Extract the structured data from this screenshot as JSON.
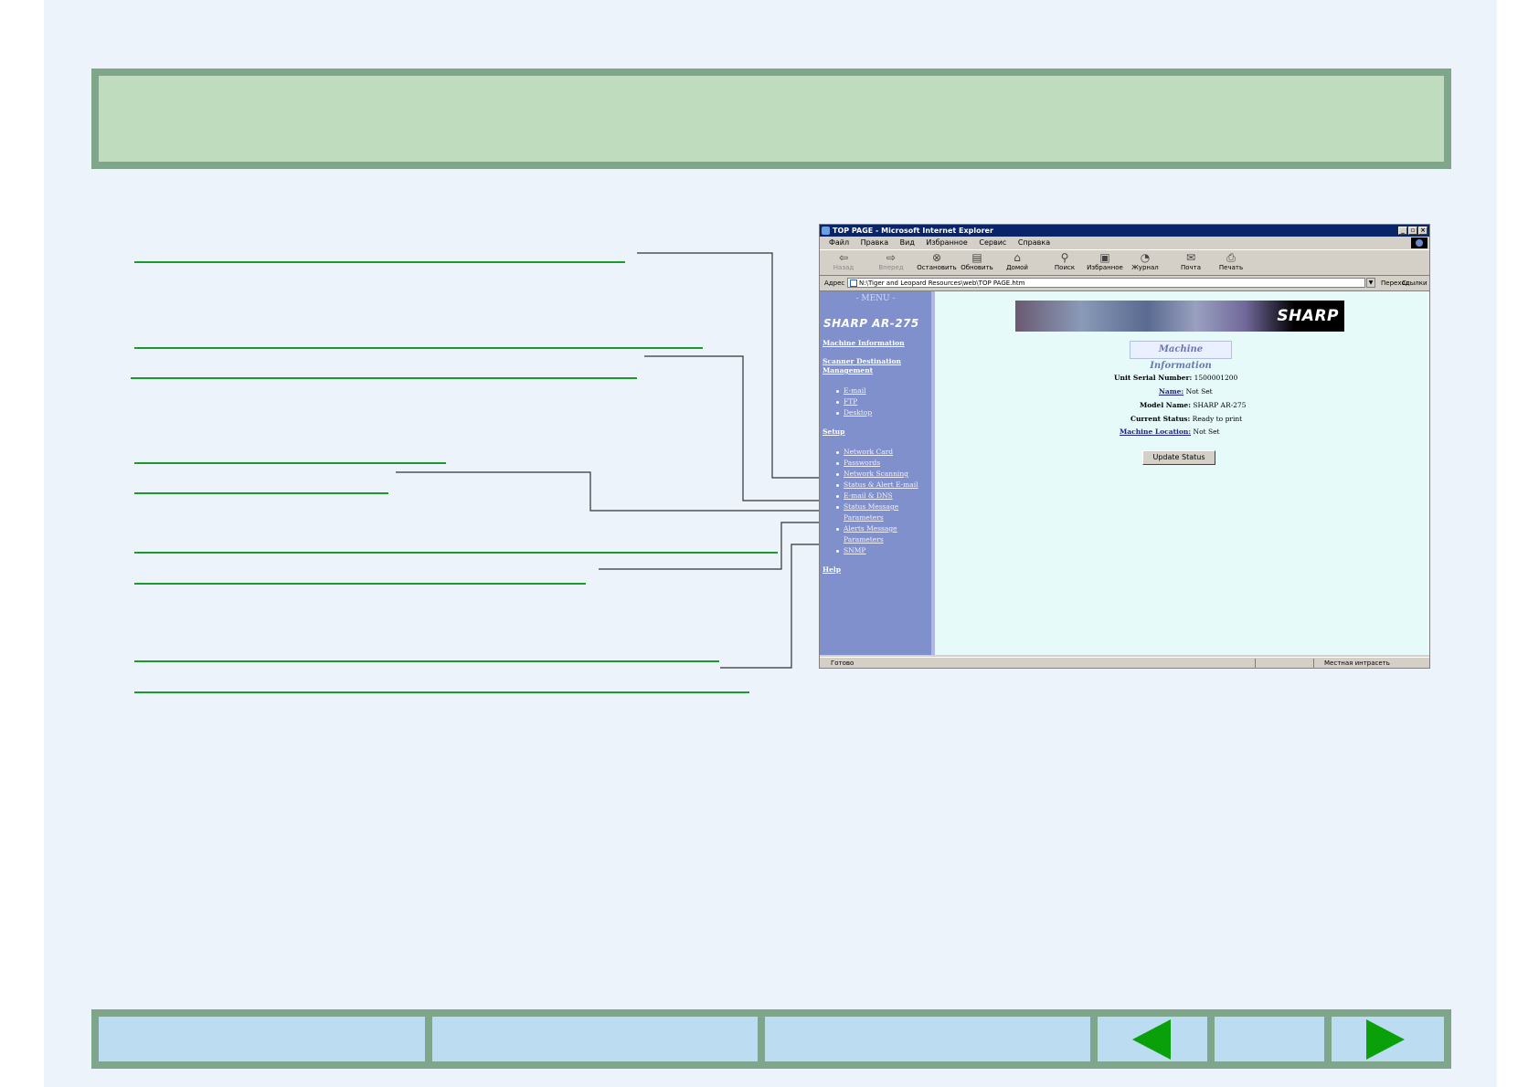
{
  "browser": {
    "window_title": "TOP PAGE - Microsoft Internet Explorer",
    "menu": [
      "Файл",
      "Правка",
      "Вид",
      "Избранное",
      "Сервис",
      "Справка"
    ],
    "toolbar": {
      "back": "Назад",
      "forward": "Вперед",
      "stop": "Остановить",
      "refresh": "Обновить",
      "home": "Домой",
      "search": "Поиск",
      "favorites": "Избранное",
      "history": "Журнал",
      "mail": "Почта",
      "print": "Печать"
    },
    "address_label": "Адрес",
    "address_value": "N:\\Tiger and Leopard Resources\\web\\TOP PAGE.htm",
    "go_label": "Переход",
    "links_label": "Ссылки",
    "status_text": "Готово",
    "status_zone": "Местная интрасеть"
  },
  "sidebar": {
    "menu_title": "- MENU -",
    "model": "SHARP AR-275",
    "machine_information": "Machine Information",
    "scanner_destination_line1": "Scanner Destination",
    "scanner_destination_line2": "Management",
    "email": "E-mail",
    "ftp": "FTP",
    "desktop": "Desktop",
    "setup": "Setup",
    "network_card": "Network Card",
    "passwords": "Passwords",
    "network_scanning": "Network Scanning",
    "status_alert_email": "Status & Alert E-mail",
    "email_dns": "E-mail & DNS",
    "status_message_line1": "Status Message",
    "status_message_line2": "Parameters",
    "alerts_message_line1": "Alerts Message",
    "alerts_message_line2": "Parameters",
    "snmp": "SNMP",
    "help": "Help"
  },
  "main": {
    "brand": "SHARP",
    "title": "Machine Information",
    "serial_label": "Unit Serial Number:",
    "serial_value": "1500001200",
    "name_label": "Name:",
    "name_value": "Not Set",
    "model_label": "Model Name:",
    "model_value": "SHARP AR-275",
    "status_label": "Current Status:",
    "status_value": "Ready to print",
    "location_label": "Machine Location:",
    "location_value": "Not Set",
    "update_button": "Update Status"
  },
  "colors": {
    "header_band": "#7fa68a",
    "header_fill": "#bfdcbf",
    "callout_line": "#1a9a2a",
    "nav_fill": "#bcdcf2",
    "arrow": "#0aa00a",
    "sidebar": "#8090cc",
    "content_bg": "#e6fafa"
  },
  "icons": {
    "prev": "triangle-left-icon",
    "next": "triangle-right-icon"
  }
}
